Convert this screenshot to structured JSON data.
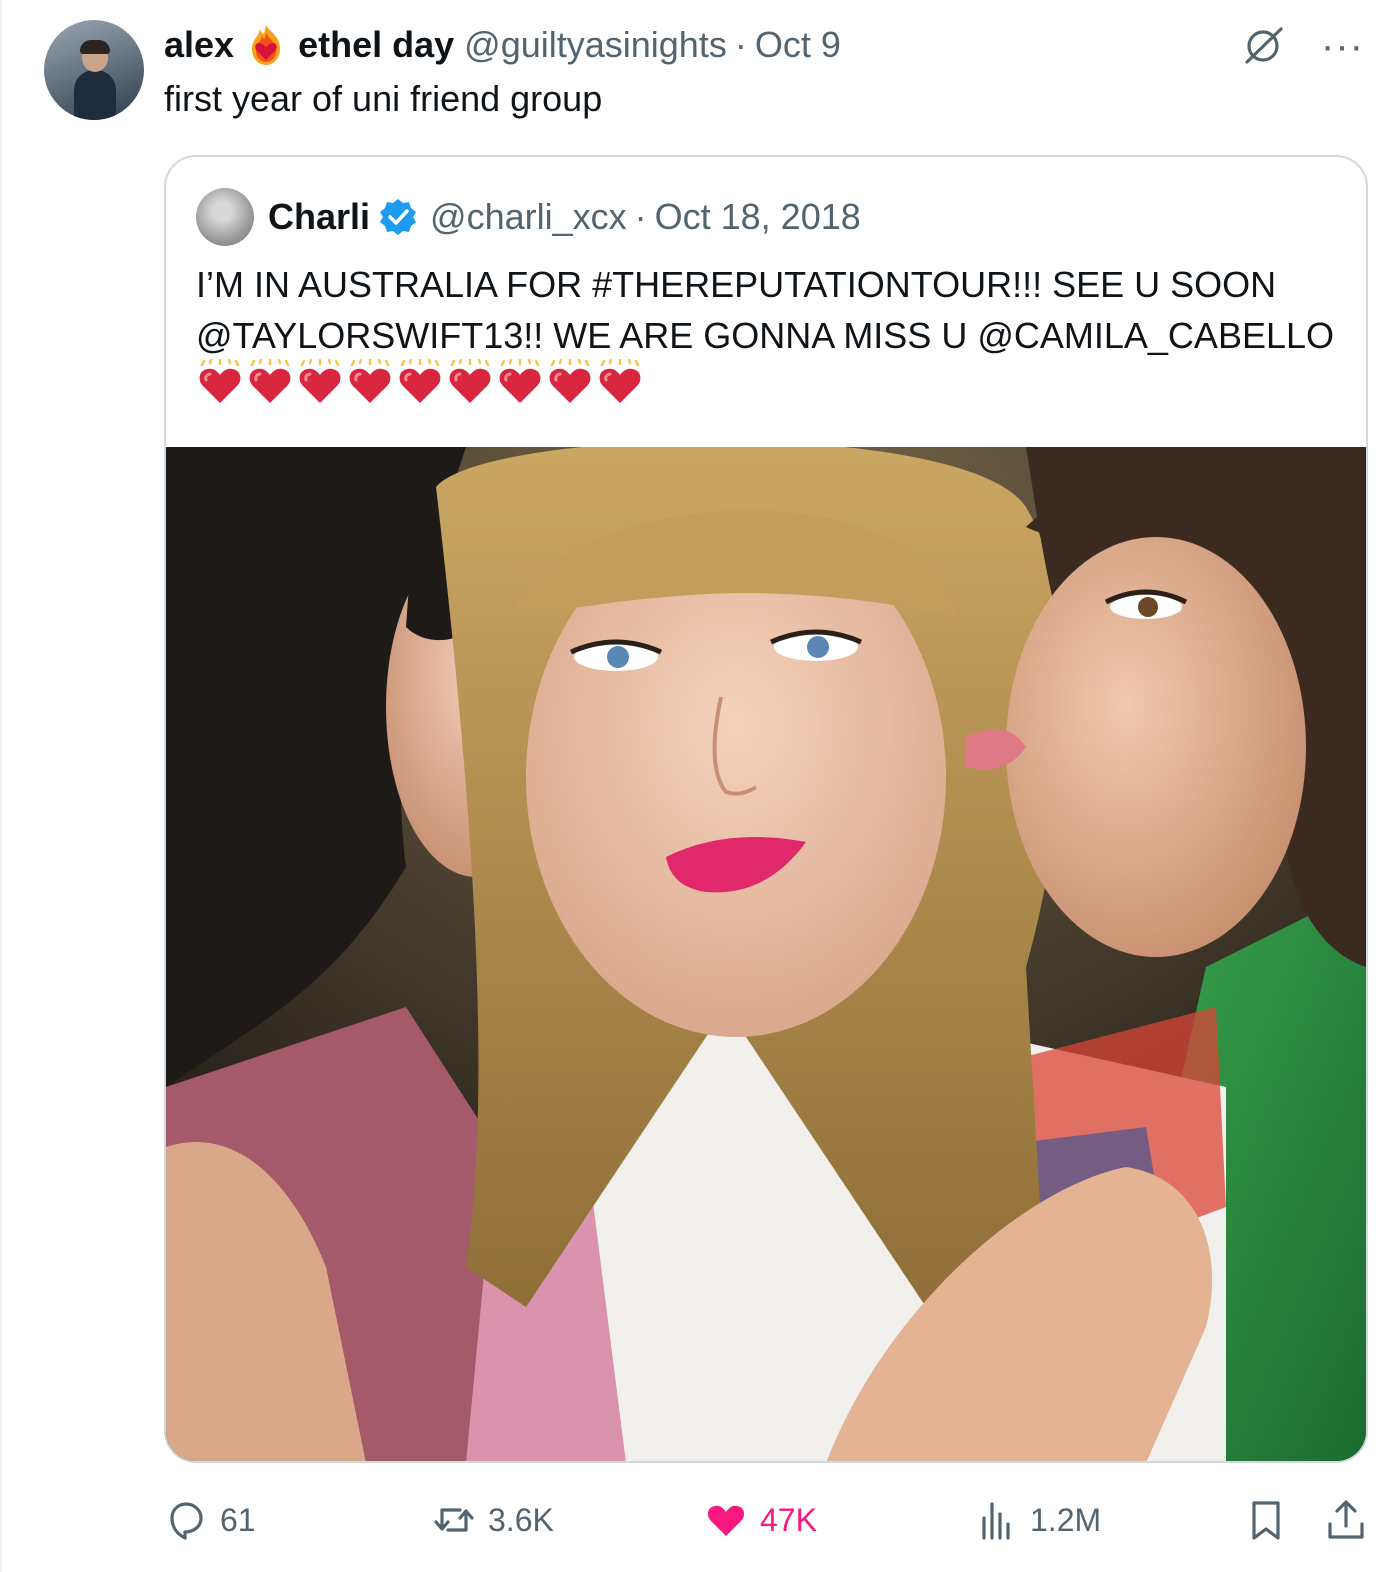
{
  "tweet": {
    "display_name": "alex",
    "display_name_2": "ethel day",
    "handle": "@guiltyasinights",
    "separator": "·",
    "date": "Oct 9",
    "text": "first year of uni friend group",
    "more": "···"
  },
  "quoted_tweet": {
    "name": "Charli",
    "handle": "@charli_xcx",
    "separator": "·",
    "date": "Oct 18, 2018",
    "text": "I’M IN AUSTRALIA FOR #THEREPUTATIONTOUR!!! SEE U SOON @TAYLORSWIFT13!! WE ARE GONNA MISS U @CAMILA_CABELLO",
    "emoji_count": 9,
    "emoji": "sparkling-heart"
  },
  "stats": {
    "replies": "61",
    "reposts": "3.6K",
    "likes": "47K",
    "views": "1.2M"
  },
  "colors": {
    "text_primary": "#0f1419",
    "text_secondary": "#536471",
    "border": "#cfd9de",
    "like_active": "#f91880",
    "verified": "#1d9bf0"
  }
}
